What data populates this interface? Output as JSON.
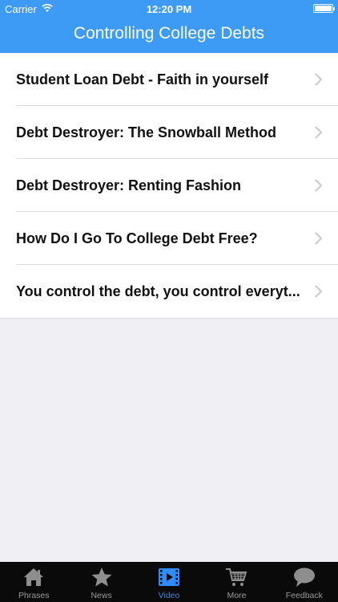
{
  "status_bar": {
    "carrier": "Carrier",
    "time": "12:20 PM"
  },
  "nav": {
    "title": "Controlling College Debts"
  },
  "list": {
    "items": [
      {
        "label": "Student Loan Debt - Faith in yourself"
      },
      {
        "label": "Debt Destroyer: The Snowball Method"
      },
      {
        "label": "Debt Destroyer: Renting Fashion"
      },
      {
        "label": "How Do I Go To College Debt Free?"
      },
      {
        "label": "You control the debt, you control everyt..."
      }
    ]
  },
  "tabbar": {
    "active_color": "#2f8cff",
    "inactive_color": "#9a9a9a",
    "tabs": [
      {
        "label": "Phrases",
        "icon": "house-icon"
      },
      {
        "label": "News",
        "icon": "star-icon"
      },
      {
        "label": "Video",
        "icon": "film-icon",
        "active": true
      },
      {
        "label": "More",
        "icon": "cart-icon"
      },
      {
        "label": "Feedback",
        "icon": "speech-bubble-icon"
      }
    ]
  },
  "colors": {
    "header": "#3d9bf6",
    "background": "#efeff4"
  }
}
